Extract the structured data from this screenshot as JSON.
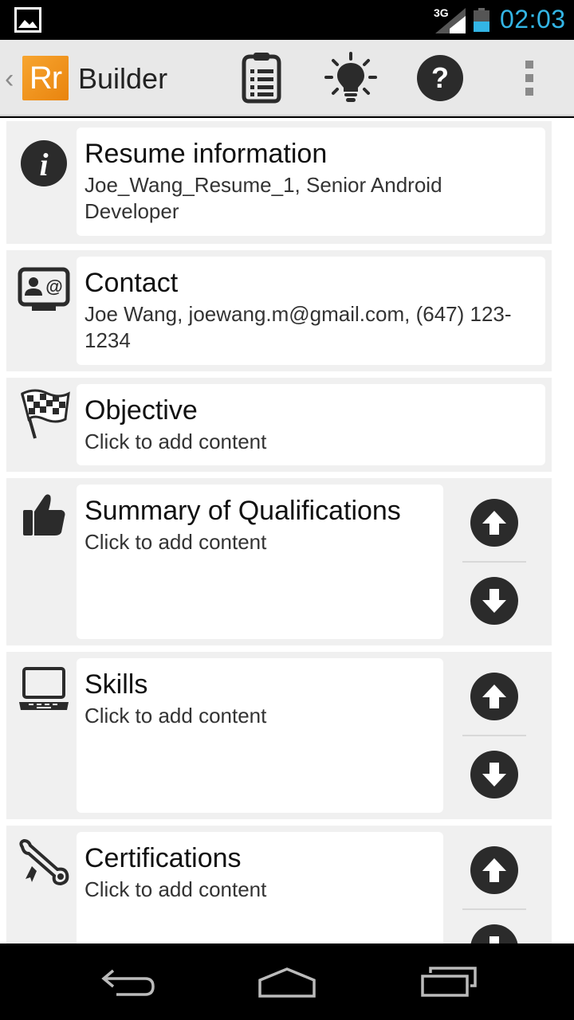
{
  "status_bar": {
    "network": "3G",
    "time": "02:03",
    "icons": [
      "gallery-notification-icon",
      "signal-icon",
      "battery-icon"
    ]
  },
  "action_bar": {
    "logo_text": "Rr",
    "title": "Builder",
    "actions": [
      "document-list-icon",
      "lightbulb-icon",
      "help-icon",
      "overflow-menu-icon"
    ]
  },
  "sections": [
    {
      "icon": "info-icon",
      "title": "Resume information",
      "subtitle": "Joe_Wang_Resume_1, Senior Android Developer"
    },
    {
      "icon": "contact-card-icon",
      "title": "Contact",
      "subtitle": "Joe Wang, joewang.m@gmail.com, (647) 123-1234"
    },
    {
      "icon": "checkered-flag-icon",
      "title": "Objective",
      "subtitle": "Click to add content"
    },
    {
      "icon": "thumbs-up-icon",
      "title": "Summary of Qualifications",
      "subtitle": "Click to add content",
      "reorderable": true
    },
    {
      "icon": "laptop-icon",
      "title": "Skills",
      "subtitle": "Click to add content",
      "reorderable": true
    },
    {
      "icon": "diploma-scroll-icon",
      "title": "Certifications",
      "subtitle": "Click to add content",
      "reorderable": true
    }
  ],
  "nav_bar": {
    "buttons": [
      "back-icon",
      "home-icon",
      "recent-apps-icon"
    ]
  },
  "colors": {
    "accent": "#33b5e5",
    "logo": "#f39a1f",
    "action_bar": "#e8e8e8",
    "section_bg": "#f0f0f0"
  }
}
